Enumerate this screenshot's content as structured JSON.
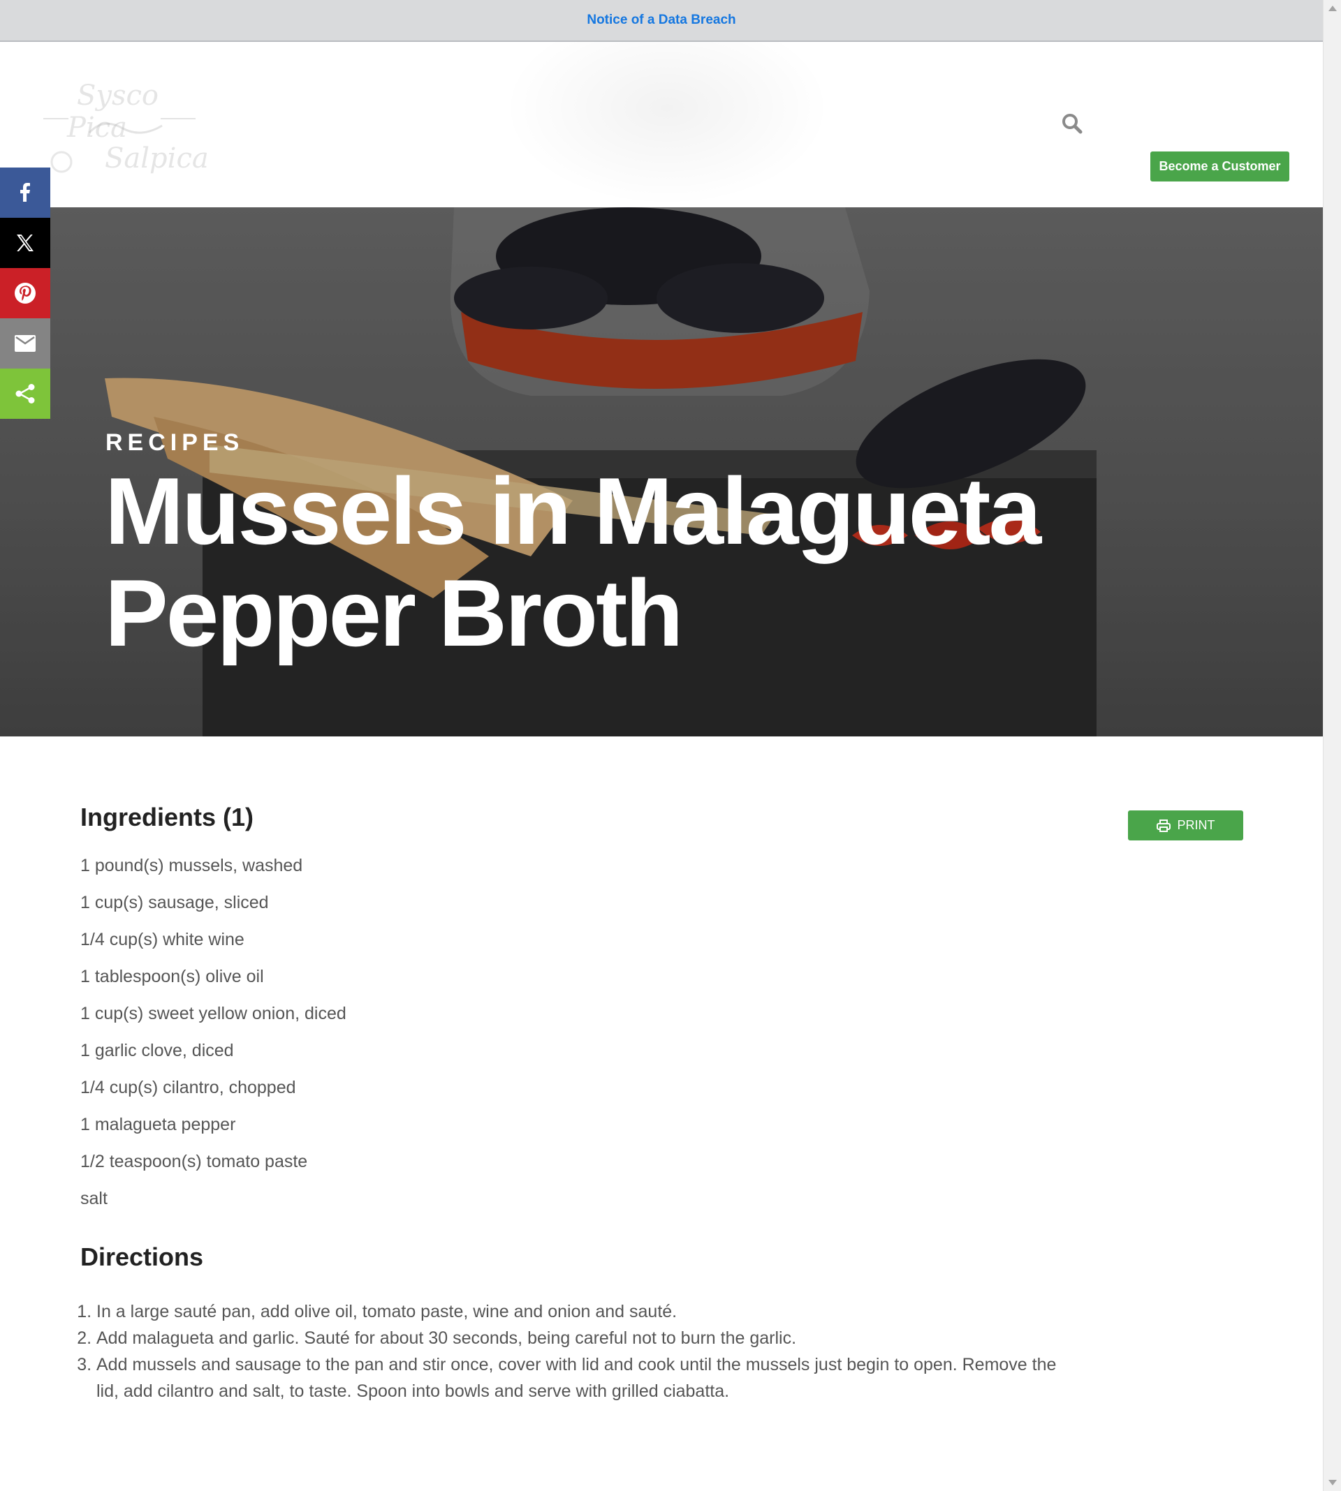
{
  "notice": {
    "link": "Notice of a Data Breach"
  },
  "header": {
    "logo_text": [
      "Sysco",
      "Pica",
      "Salpica"
    ],
    "search_icon": "search-icon",
    "cta_label": "Become a Customer"
  },
  "hero": {
    "eyebrow": "RECIPES",
    "title": "Mussels in Malagueta Pepper Broth"
  },
  "share": {
    "items": [
      {
        "icon": "facebook-icon"
      },
      {
        "icon": "x-twitter-icon"
      },
      {
        "icon": "pinterest-icon"
      },
      {
        "icon": "email-icon"
      },
      {
        "icon": "share-icon"
      }
    ]
  },
  "ingredients": {
    "title": "Ingredients (1)",
    "print_label": "PRINT",
    "items": [
      "1 pound(s) mussels, washed",
      "1 cup(s) sausage, sliced",
      "1/4 cup(s) white wine",
      "1 tablespoon(s) olive oil",
      "1 cup(s) sweet yellow onion, diced",
      "1 garlic clove, diced",
      "1/4 cup(s) cilantro, chopped",
      "1 malagueta pepper",
      "1/2 teaspoon(s) tomato paste",
      "salt"
    ]
  },
  "directions": {
    "title": "Directions",
    "steps": [
      "In a large sauté pan, add olive oil, tomato paste, wine and onion and sauté.",
      "Add malagueta and garlic. Sauté for about 30 seconds, being careful not to burn the garlic.",
      "Add mussels and sausage to the pan and stir once, cover with lid and cook until the mussels just begin to open. Remove the lid, add cilantro and salt, to taste. Spoon into bowls and serve with grilled ciabatta."
    ]
  },
  "colors": {
    "accent_green": "#4aa54a",
    "link_blue": "#1577e0",
    "facebook": "#3b5998",
    "pinterest": "#cb2027",
    "share_green": "#7ec43a"
  }
}
